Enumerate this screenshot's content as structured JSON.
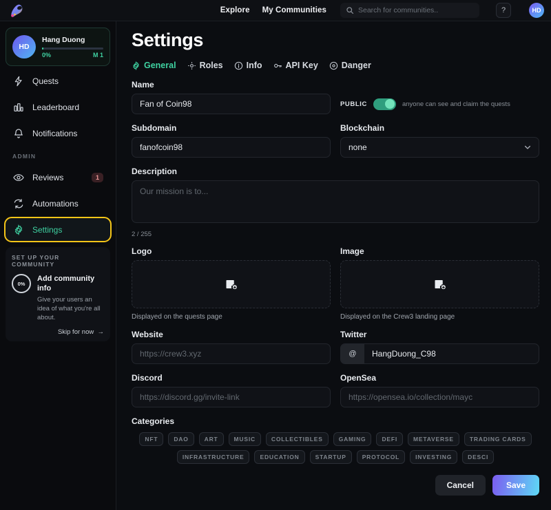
{
  "topbar": {
    "logo_icon": "crew3-logo-icon",
    "nav": [
      {
        "label": "Explore",
        "name": "explore"
      },
      {
        "label": "My Communities",
        "name": "my-communities"
      }
    ],
    "search": {
      "placeholder": "Search for communities..",
      "value": "",
      "icon": "search-icon"
    },
    "help_label": "?",
    "avatar_initials": "HD"
  },
  "sidebar": {
    "profile": {
      "initials": "HD",
      "name": "Hang Duong",
      "progress_label": "0%",
      "progress_percent": 0,
      "level_label": "M 1"
    },
    "items": [
      {
        "label": "Quests",
        "icon": "bolt-icon",
        "badge": ""
      },
      {
        "label": "Leaderboard",
        "icon": "bar-chart-icon",
        "badge": ""
      },
      {
        "label": "Notifications",
        "icon": "bell-icon",
        "badge": ""
      }
    ],
    "admin_section_label": "ADMIN",
    "admin_items": [
      {
        "label": "Reviews",
        "icon": "eye-icon",
        "badge": "1"
      },
      {
        "label": "Automations",
        "icon": "sync-icon",
        "badge": ""
      },
      {
        "label": "Settings",
        "icon": "gear-icon",
        "badge": ""
      }
    ],
    "setup_card": {
      "title": "SET UP YOUR COMMUNITY",
      "ring_label": "0%",
      "heading": "Add community info",
      "description": "Give your users an idea of what you're all about.",
      "skip_label": "Skip for now",
      "skip_icon": "arrow-right-icon"
    }
  },
  "main": {
    "title": "Settings",
    "tabs": [
      {
        "label": "General",
        "icon": "gear-icon",
        "active": true
      },
      {
        "label": "Roles",
        "icon": "roles-icon",
        "active": false
      },
      {
        "label": "Info",
        "icon": "info-icon",
        "active": false
      },
      {
        "label": "API Key",
        "icon": "key-icon",
        "active": false
      },
      {
        "label": "Danger",
        "icon": "danger-icon",
        "active": false
      }
    ],
    "name": {
      "label": "Name",
      "value": "Fan of Coin98",
      "placeholder": ""
    },
    "public": {
      "label": "PUBLIC",
      "enabled": true,
      "hint": "anyone can see and claim the quests"
    },
    "subdomain": {
      "label": "Subdomain",
      "value": "fanofcoin98",
      "placeholder": ""
    },
    "blockchain": {
      "label": "Blockchain",
      "value": "none",
      "chevron_icon": "chevron-down-icon"
    },
    "description": {
      "label": "Description",
      "value": "",
      "placeholder": "Our mission is to...",
      "counter": "2 / 255"
    },
    "logo": {
      "label": "Logo",
      "caption": "Displayed on the quests page",
      "icon": "add-image-icon"
    },
    "image": {
      "label": "Image",
      "caption": "Displayed on the Crew3 landing page",
      "icon": "add-image-icon"
    },
    "website": {
      "label": "Website",
      "value": "",
      "placeholder": "https://crew3.xyz"
    },
    "twitter": {
      "label": "Twitter",
      "prefix": "@",
      "value": "HangDuong_C98",
      "placeholder": ""
    },
    "discord": {
      "label": "Discord",
      "value": "",
      "placeholder": "https://discord.gg/invite-link"
    },
    "opensea": {
      "label": "OpenSea",
      "value": "",
      "placeholder": "https://opensea.io/collection/mayc"
    },
    "categories": {
      "label": "Categories",
      "chips": [
        "NFT",
        "DAO",
        "ART",
        "MUSIC",
        "COLLECTIBLES",
        "GAMING",
        "DEFI",
        "METAVERSE",
        "TRADING CARDS",
        "INFRASTRUCTURE",
        "EDUCATION",
        "STARTUP",
        "PROTOCOL",
        "INVESTING",
        "DESCI"
      ]
    },
    "actions": {
      "cancel_label": "Cancel",
      "save_label": "Save"
    }
  },
  "colors": {
    "accent_green": "#3fd1a1",
    "highlight_yellow": "#f5c518",
    "save_gradient_from": "#7b5cf0",
    "save_gradient_to": "#5ed9f5",
    "page_bg": "#0b0d11",
    "badge_red": "#e99999"
  }
}
